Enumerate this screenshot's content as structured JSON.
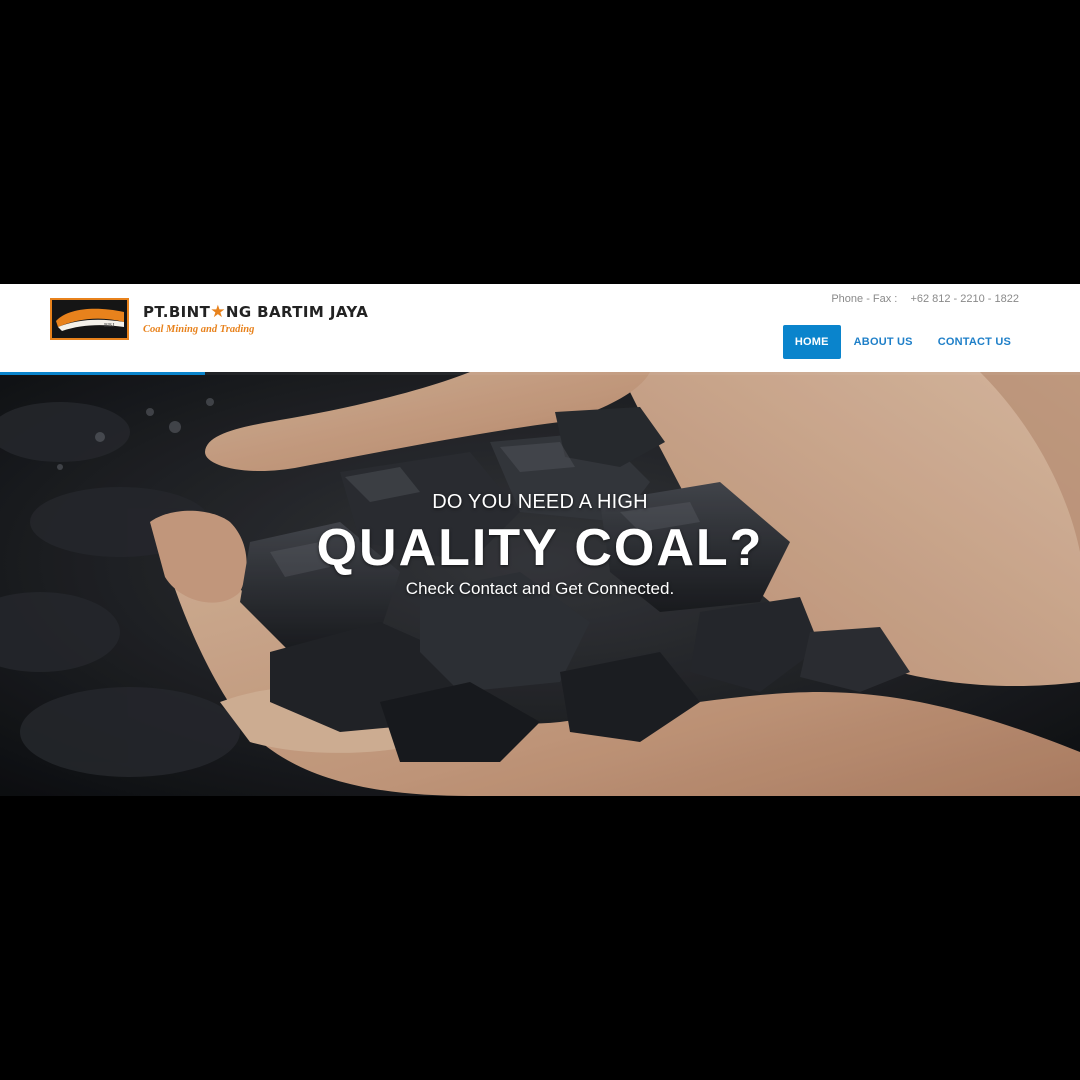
{
  "brand": {
    "name_part1": "PT.BINT",
    "name_star": "★",
    "name_part2": "NG BARTIM JAYA",
    "tagline": "Coal Mining and Trading",
    "badge_text": "BBJ",
    "accent_color": "#e8821c"
  },
  "header": {
    "phone_label": "Phone - Fax :",
    "phone_value": "+62 812 - 2210 - 1822"
  },
  "nav": {
    "items": [
      {
        "label": "HOME",
        "active": true
      },
      {
        "label": "ABOUT US",
        "active": false
      },
      {
        "label": "CONTACT US",
        "active": false
      }
    ],
    "accent_color": "#0a84cc"
  },
  "hero": {
    "kicker": "DO YOU NEED A HIGH",
    "title": "QUALITY COAL?",
    "subtitle": "Check Contact and Get Connected.",
    "background_description_icon": "hands-holding-coal-image",
    "slide_progress": 0.19
  }
}
